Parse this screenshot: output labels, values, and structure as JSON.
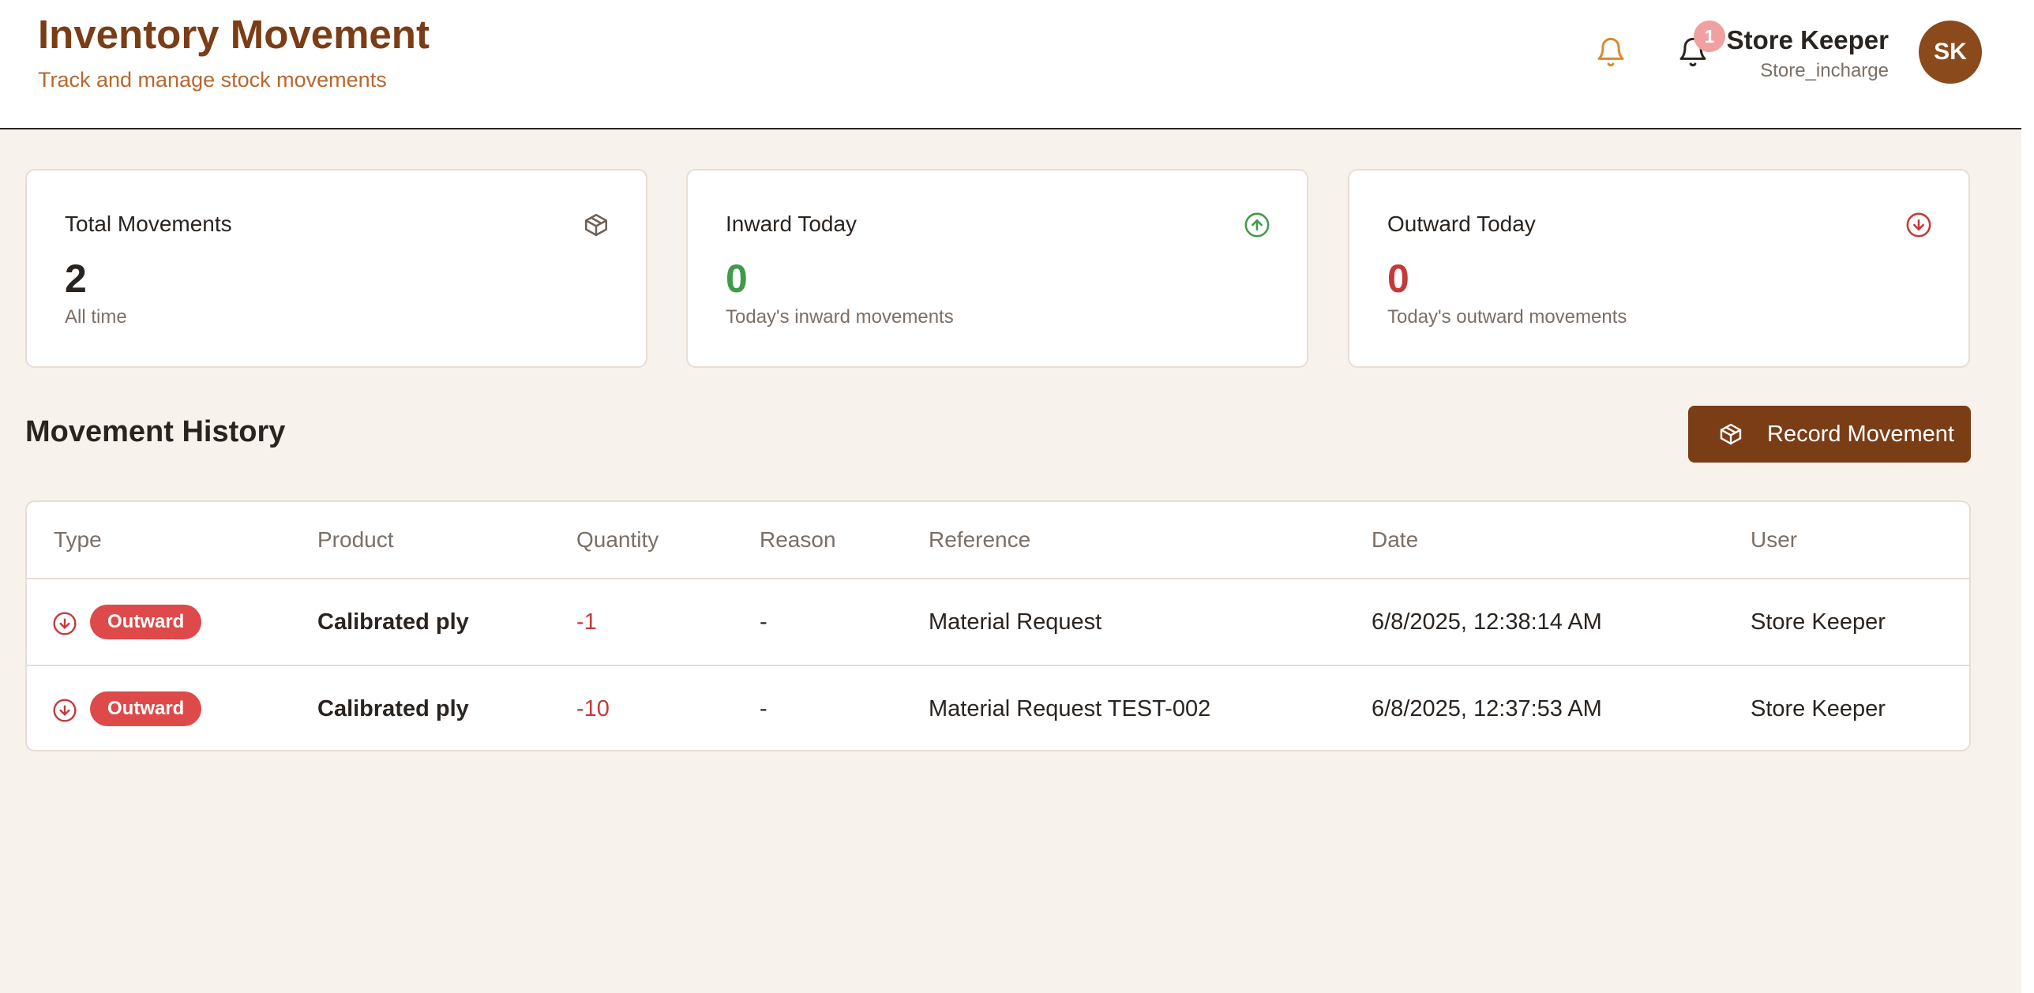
{
  "header": {
    "title": "Inventory Movement",
    "subtitle": "Track and manage stock movements",
    "notification_count": "1",
    "user": {
      "name": "Store Keeper",
      "role": "Store_incharge",
      "initials": "SK"
    }
  },
  "stats": [
    {
      "label": "Total Movements",
      "value": "2",
      "hint": "All time",
      "icon": "package-icon",
      "color": "#2a2420"
    },
    {
      "label": "Inward Today",
      "value": "0",
      "hint": "Today's inward movements",
      "icon": "arrow-up-circle-icon",
      "color": "#3f9a4a"
    },
    {
      "label": "Outward Today",
      "value": "0",
      "hint": "Today's outward movements",
      "icon": "arrow-down-circle-icon",
      "color": "#c43a3a"
    }
  ],
  "history": {
    "title": "Movement History",
    "record_button": "Record Movement",
    "columns": [
      "Type",
      "Product",
      "Quantity",
      "Reason",
      "Reference",
      "Date",
      "User"
    ],
    "rows": [
      {
        "type": "Outward",
        "product": "Calibrated ply",
        "quantity": "-1",
        "reason": "-",
        "reference": "Material Request",
        "date": "6/8/2025, 12:38:14 AM",
        "user": "Store Keeper"
      },
      {
        "type": "Outward",
        "product": "Calibrated ply",
        "quantity": "-10",
        "reason": "-",
        "reference": "Material Request TEST-002",
        "date": "6/8/2025, 12:37:53 AM",
        "user": "Store Keeper"
      }
    ]
  },
  "colors": {
    "brand": "#7a3d16",
    "accent": "#b8672e",
    "inward": "#3f9a4a",
    "outward": "#c43a3a",
    "background": "#f7f3ec"
  }
}
